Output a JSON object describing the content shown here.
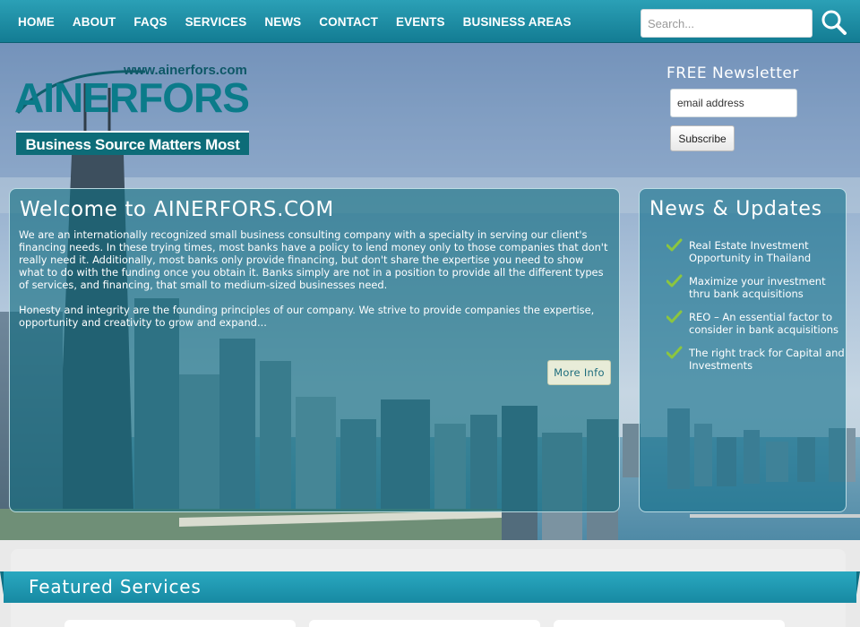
{
  "nav": {
    "items": [
      "HOME",
      "ABOUT",
      "FAQS",
      "SERVICES",
      "NEWS",
      "CONTACT",
      "EVENTS",
      "BUSINESS AREAS"
    ],
    "search_placeholder": "Search..."
  },
  "logo": {
    "url": "www.ainerfors.com",
    "name": "AINERFORS",
    "tagline": "Business Source Matters Most"
  },
  "newsletter": {
    "title": "FREE Newsletter",
    "email_placeholder": "email address",
    "subscribe_label": "Subscribe"
  },
  "welcome": {
    "title": "Welcome to AINERFORS.COM",
    "paragraphs": [
      "We are an internationally recognized small business consulting company with a specialty in serving our client's financing needs. In these trying times, most banks have a policy to lend money only to those companies that don't really need it. Additionally, most banks only provide financing, but don't share the expertise you need to show what to do with the funding once you obtain it. Banks simply are not in a position to provide all the different types of services, and financing, that small to medium-sized businesses need.",
      "Honesty and integrity are the founding principles of our company. We strive to provide companies the expertise, opportunity and creativity to grow and expand..."
    ],
    "more_info_label": "More Info"
  },
  "news": {
    "title": "News & Updates",
    "items": [
      "Real Estate Investment Opportunity in Thailand",
      "Maximize your investment thru bank acquisitions",
      "REO – An essential factor to consider in bank acquisitions",
      "The right track for Capital and Investments"
    ]
  },
  "featured": {
    "title": "Featured Services"
  },
  "colors": {
    "nav": "#137c93",
    "accent": "#2aa8c0",
    "panel": "#106c80",
    "logo": "#0b7b8a",
    "check": "#8cc63f"
  }
}
